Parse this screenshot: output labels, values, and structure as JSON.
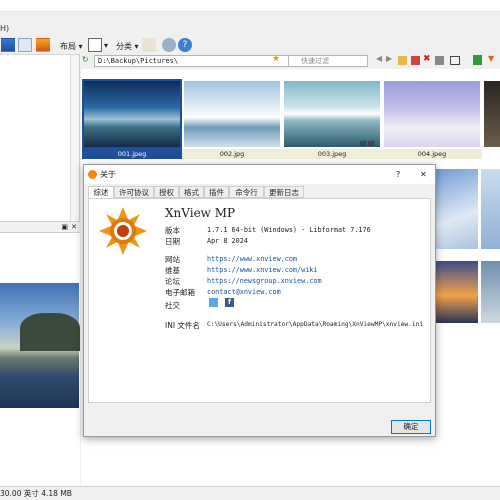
{
  "menubar": {
    "stub": "H)"
  },
  "toolbar": {
    "layout_label": "布局",
    "category_label": "分类"
  },
  "address": {
    "path": "D:\\Backup\\Pictures\\",
    "search_placeholder": "快速过滤"
  },
  "thumbnails": [
    {
      "caption": "001.jpeg",
      "selected": true
    },
    {
      "caption": "002.jpg",
      "selected": false
    },
    {
      "caption": "003.jpeg",
      "selected": false
    },
    {
      "caption": "004.jpeg",
      "selected": false
    }
  ],
  "status": {
    "text": "30.00 英寸  4.18 MB"
  },
  "dialog": {
    "title": "关于",
    "help": "?",
    "close": "✕",
    "tabs": [
      "综述",
      "许可协议",
      "授权",
      "格式",
      "插件",
      "命令行",
      "更新日志"
    ],
    "app_name": "XnView MP",
    "rows": [
      {
        "label": "版本",
        "value": "1.7.1 64-bit (Windows) - Libformat 7.176",
        "link": false
      },
      {
        "label": "日期",
        "value": "Apr  8 2024",
        "link": false
      },
      {
        "label": "网站",
        "value": "https://www.xnview.com",
        "link": true
      },
      {
        "label": "维基",
        "value": "https://www.xnview.com/wiki",
        "link": true
      },
      {
        "label": "论坛",
        "value": "https://newsgroup.xnview.com",
        "link": true
      },
      {
        "label": "电子邮箱",
        "value": "contact@xnview.com",
        "link": true
      }
    ],
    "social_label": "社交",
    "ini_label": "INI 文件名",
    "ini_value": "C:\\Users\\Administrator\\AppData\\Roaming\\XnViewMP\\xnview.ini",
    "ok": "确定"
  }
}
